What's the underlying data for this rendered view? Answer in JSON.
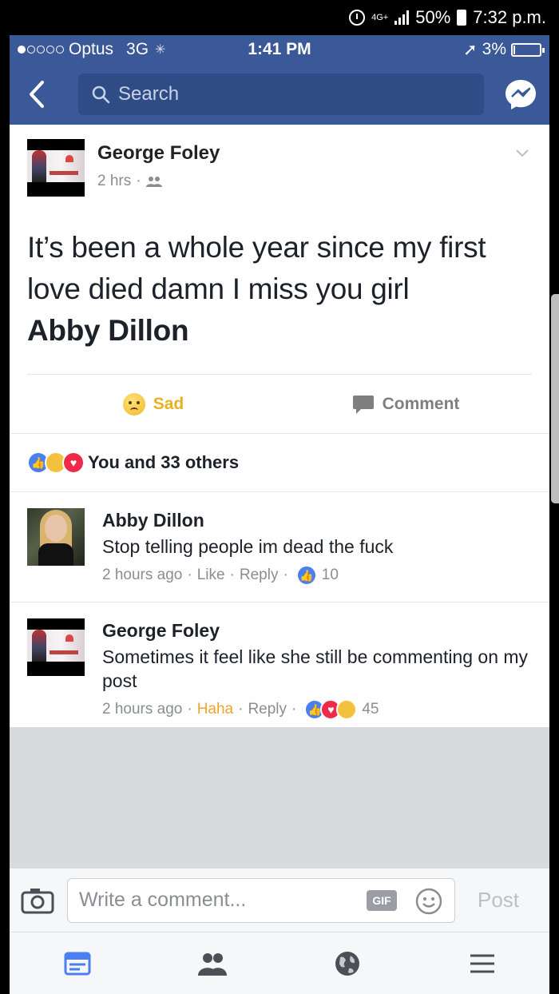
{
  "android_status": {
    "network": "4G+",
    "battery": "50%",
    "time": "7:32 p.m."
  },
  "ios_status": {
    "carrier": "Optus",
    "network": "3G",
    "time": "1:41 PM",
    "battery": "3%"
  },
  "nav": {
    "search_placeholder": "Search"
  },
  "post": {
    "author": "George Foley",
    "time": "2 hrs",
    "text": "It’s been a whole year since my first love died damn I miss you girl",
    "tagged": "Abby Dillon",
    "actions": {
      "reaction_label": "Sad",
      "comment_label": "Comment"
    },
    "reactions_summary": "You and 33 others"
  },
  "comments": [
    {
      "author": "Abby Dillon",
      "body": "Stop telling people im dead the fuck",
      "time": "2 hours ago",
      "react_label": "Like",
      "reply_label": "Reply",
      "count": "10"
    },
    {
      "author": "George Foley",
      "body": "Sometimes it feel like she still be commenting on my post",
      "time": "2 hours ago",
      "react_label": "Haha",
      "reply_label": "Reply",
      "count": "45"
    }
  ],
  "composer": {
    "placeholder": "Write a comment...",
    "gif_label": "GIF",
    "post_label": "Post"
  },
  "colors": {
    "brand": "#3b5998",
    "sad": "#e9b122",
    "haha": "#f2a42b"
  }
}
